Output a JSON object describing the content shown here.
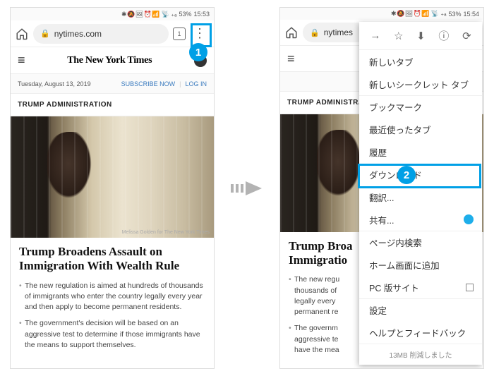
{
  "status": {
    "icons": "✱ 🔕 🖼 ⏰ 📶",
    "net": "📡 ₊ₐ",
    "batt_pct": "53%",
    "time1": "15:53",
    "time2": "15:54"
  },
  "url_full": "nytimes.com",
  "url_short": "nytimes",
  "header": {
    "logo": "The New York Times"
  },
  "date": "Tuesday, August 13, 2019",
  "links": {
    "subscribe": "SUBSCRIBE NOW",
    "login": "LOG IN"
  },
  "kicker": "TRUMP ADMINISTRATION",
  "credit": "Melissa Golden for The New York Times",
  "headline": "Trump Broadens Assault on Immigration With Wealth Rule",
  "bullets": [
    "The new regulation is aimed at hundreds of thousands of immigrants who enter the country legally every year and then apply to become permanent residents.",
    "The government's decision will be based on an aggressive test to determine if those immigrants have the means to support themselves."
  ],
  "menu": {
    "new_tab": "新しいタブ",
    "incognito": "新しいシークレット タブ",
    "bookmarks": "ブックマーク",
    "recent": "最近使ったタブ",
    "history": "履歴",
    "downloads": "ダウンロード",
    "translate": "翻訳...",
    "share": "共有...",
    "find": "ページ内検索",
    "homescreen": "ホーム画面に追加",
    "desktop": "PC 版サイト",
    "settings": "設定",
    "help": "ヘルプとフィードバック",
    "footer": "13MB 削減しました"
  },
  "badges": {
    "one": "1",
    "two": "2"
  }
}
